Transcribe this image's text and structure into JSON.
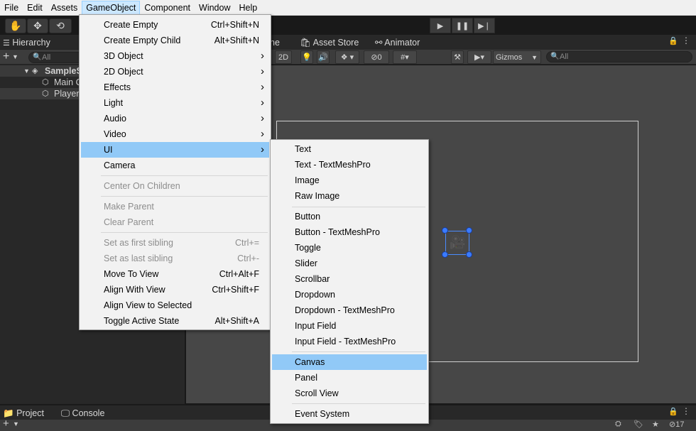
{
  "menubar": [
    "File",
    "Edit",
    "Assets",
    "GameObject",
    "Component",
    "Window",
    "Help"
  ],
  "hierarchy": {
    "tab_label": "Hierarchy",
    "search_placeholder": "All",
    "rows": [
      "SampleS",
      "Main C",
      "Player"
    ]
  },
  "scene": {
    "tabs": [
      "ne",
      "Asset Store",
      "Animator"
    ],
    "toolbar": {
      "mode_2d": "2D",
      "hidden_count": "0",
      "gizmos": "Gizmos",
      "search_placeholder": "All"
    }
  },
  "bottom": {
    "tabs": [
      "Project",
      "Console"
    ],
    "count": "17"
  },
  "gameobject_menu": [
    {
      "label": "Create Empty",
      "shortcut": "Ctrl+Shift+N",
      "state": "normal"
    },
    {
      "label": "Create Empty Child",
      "shortcut": "Alt+Shift+N",
      "state": "normal"
    },
    {
      "label": "3D Object",
      "submenu": true,
      "state": "normal"
    },
    {
      "label": "2D Object",
      "submenu": true,
      "state": "normal"
    },
    {
      "label": "Effects",
      "submenu": true,
      "state": "normal"
    },
    {
      "label": "Light",
      "submenu": true,
      "state": "normal"
    },
    {
      "label": "Audio",
      "submenu": true,
      "state": "normal"
    },
    {
      "label": "Video",
      "submenu": true,
      "state": "normal"
    },
    {
      "label": "UI",
      "submenu": true,
      "state": "highlighted"
    },
    {
      "label": "Camera",
      "state": "normal"
    },
    {
      "label": "Center On Children",
      "state": "disabled"
    },
    {
      "label": "Make Parent",
      "state": "disabled"
    },
    {
      "label": "Clear Parent",
      "state": "disabled"
    },
    {
      "label": "Set as first sibling",
      "shortcut": "Ctrl+=",
      "state": "disabled"
    },
    {
      "label": "Set as last sibling",
      "shortcut": "Ctrl+-",
      "state": "disabled"
    },
    {
      "label": "Move To View",
      "shortcut": "Ctrl+Alt+F",
      "state": "normal"
    },
    {
      "label": "Align With View",
      "shortcut": "Ctrl+Shift+F",
      "state": "normal"
    },
    {
      "label": "Align View to Selected",
      "state": "normal"
    },
    {
      "label": "Toggle Active State",
      "shortcut": "Alt+Shift+A",
      "state": "normal"
    }
  ],
  "ui_submenu": [
    {
      "label": "Text",
      "state": "normal"
    },
    {
      "label": "Text - TextMeshPro",
      "state": "normal"
    },
    {
      "label": "Image",
      "state": "normal"
    },
    {
      "label": "Raw Image",
      "state": "normal"
    },
    {
      "label": "Button",
      "state": "normal"
    },
    {
      "label": "Button - TextMeshPro",
      "state": "normal"
    },
    {
      "label": "Toggle",
      "state": "normal"
    },
    {
      "label": "Slider",
      "state": "normal"
    },
    {
      "label": "Scrollbar",
      "state": "normal"
    },
    {
      "label": "Dropdown",
      "state": "normal"
    },
    {
      "label": "Dropdown - TextMeshPro",
      "state": "normal"
    },
    {
      "label": "Input Field",
      "state": "normal"
    },
    {
      "label": "Input Field - TextMeshPro",
      "state": "normal"
    },
    {
      "label": "Canvas",
      "state": "highlighted"
    },
    {
      "label": "Panel",
      "state": "normal"
    },
    {
      "label": "Scroll View",
      "state": "normal"
    },
    {
      "label": "Event System",
      "state": "normal"
    }
  ],
  "colors": {
    "menu_highlight": "#91c9f7",
    "menubar_active": "#cce8ff",
    "selection_handle": "#3a7bff"
  }
}
